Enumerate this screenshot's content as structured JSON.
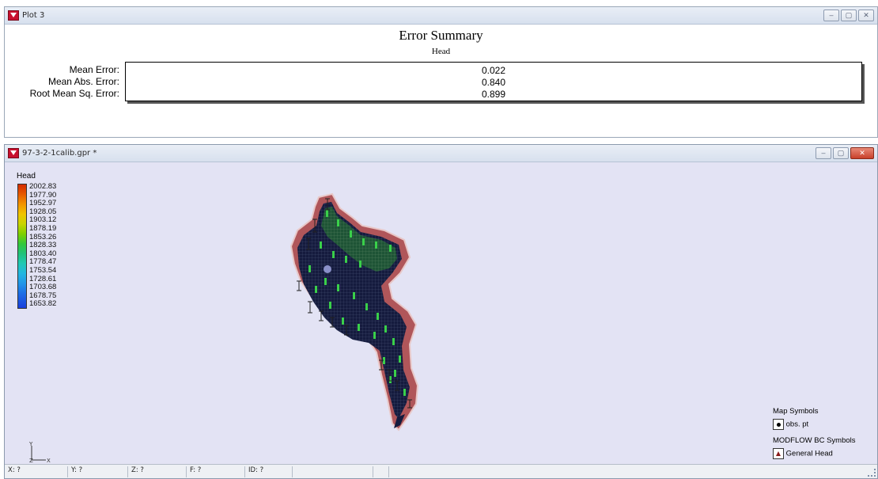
{
  "plot_window": {
    "title": "Plot 3",
    "heading": "Error Summary",
    "subheading": "Head",
    "labels": {
      "mean_error": "Mean Error:",
      "mean_abs_error": "Mean Abs. Error:",
      "rms_error": "Root Mean Sq. Error:"
    },
    "values": {
      "mean_error": "0.022",
      "mean_abs_error": "0.840",
      "rms_error": "0.899"
    },
    "controls": {
      "minimize": "–",
      "maximize": "▢",
      "close": "✕"
    }
  },
  "map_window": {
    "title": "97-3-2-1calib.gpr *",
    "controls": {
      "minimize": "–",
      "maximize": "▢",
      "close": "✕"
    },
    "legend": {
      "title": "Head",
      "values": [
        "2002.83",
        "1977.90",
        "1952.97",
        "1928.05",
        "1903.12",
        "1878.19",
        "1853.26",
        "1828.33",
        "1803.40",
        "1778.47",
        "1753.54",
        "1728.61",
        "1703.68",
        "1678.75",
        "1653.82"
      ]
    },
    "map_symbols": {
      "title": "Map Symbols",
      "obs_label": "obs. pt",
      "bc_title": "MODFLOW BC Symbols",
      "bc_label": "General Head"
    },
    "axis": {
      "y": "Y",
      "x": "X",
      "z": "Z"
    },
    "status": {
      "x": "X: ?",
      "y": "Y: ?",
      "z": "Z: ?",
      "f": "F: ?",
      "id": "ID: ?"
    }
  },
  "colors": {
    "background_map": "#e3e3f4",
    "grid_dark": "#141a3c",
    "boundary": "#b85a5a",
    "residual_green": "#3ad04a"
  }
}
